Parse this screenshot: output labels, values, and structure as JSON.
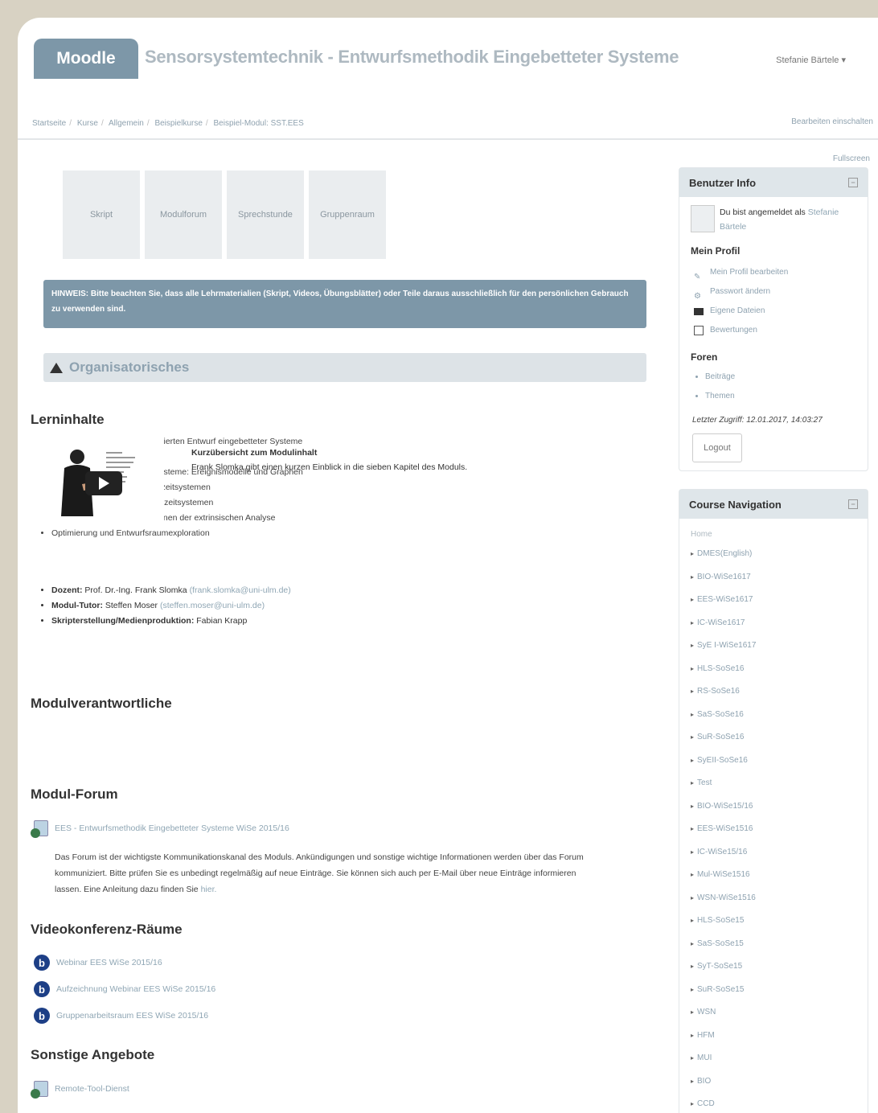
{
  "header": {
    "brand": "Moodle",
    "course_title": "Sensorsystemtechnik - Entwurfsmethodik Eingebetteter Systeme",
    "user_menu": "Stefanie Bärtele ▾"
  },
  "breadcrumb": [
    "Startseite",
    "Kurse",
    "Allgemein",
    "Beispielkurse",
    "Beispiel-Modul: SST.EES"
  ],
  "edit_toggle": "Bearbeiten einschalten",
  "fullscreen": "Fullscreen",
  "tiles": [
    "Skript",
    "Modulforum",
    "Sprechstunde",
    "Gruppenraum"
  ],
  "notice": "HINWEIS: Bitte beachten Sie, dass alle Lehrmaterialien (Skript, Videos, Übungsblätter) oder Teile daraus ausschließlich für den persönlichen Gebrauch zu verwenden sind.",
  "section": {
    "title": "Organisatorisches"
  },
  "lerninhalte": {
    "heading": "Lerninhalte",
    "items": [
      "Übersicht über den modellbasierten Entwurf eingebetteter Systeme",
      "Zeit und Echtzeitsysteme",
      "Modellierung eingebetteter Systeme: Ereignismodelle und Graphen",
      "Intrinsische Analyse von Echtzeitsystemen",
      "Extrinsische Analyse von Echtzeitsystemen",
      "Komplexität und Approximationen der extrinsischen Analyse",
      "Optimierung und Entwurfsraumexploration"
    ]
  },
  "video": {
    "title": "Kurzübersicht zum Modulinhalt",
    "description": "Frank Slomka gibt einen kurzen Einblick in die sieben Kapitel des Moduls."
  },
  "verantwortliche": {
    "heading": "Modulverantwortliche",
    "items": [
      {
        "label": "Dozent:",
        "value": "Prof. Dr.-Ing. Frank Slomka",
        "email": "(frank.slomka@uni-ulm.de)"
      },
      {
        "label": "Modul-Tutor:",
        "value": "Steffen Moser",
        "email": "(steffen.moser@uni-ulm.de)"
      },
      {
        "label": "Skripterstellung/Medienproduktion:",
        "value": "Fabian Krapp",
        "email": ""
      }
    ]
  },
  "forum": {
    "heading": "Modul-Forum",
    "link": "EES - Entwurfsmethodik Eingebetteter Systeme WiSe 2015/16",
    "text": "Das Forum ist der wichtigste Kommunikationskanal des Moduls. Ankündigungen und sonstige wichtige Informationen werden über das Forum kommuniziert. Bitte prüfen Sie es unbedingt regelmäßig auf neue Einträge. Sie können sich auch per E-Mail über neue Einträge informieren lassen. Eine Anleitung dazu finden Sie",
    "here": "hier."
  },
  "video_rooms": {
    "heading": "Videokonferenz-Räume",
    "items": [
      "Webinar EES WiSe 2015/16",
      "Aufzeichnung Webinar EES WiSe 2015/16",
      "Gruppenarbeitsraum EES WiSe 2015/16"
    ]
  },
  "other": {
    "heading": "Sonstige Angebote",
    "link": "Remote-Tool-Dienst"
  },
  "user_info": {
    "title": "Benutzer Info",
    "logged_in_prefix": "Du bist angemeldet als",
    "logged_in_name": "Stefanie Bärtele",
    "profile_heading": "Mein Profil",
    "profile_links": [
      "Mein Profil bearbeiten",
      "Passwort ändern",
      "Eigene Dateien",
      "Bewertungen"
    ],
    "forum_heading": "Foren",
    "forum_links": [
      "Beiträge",
      "Themen"
    ],
    "last_access": "Letzter Zugriff: 12.01.2017, 14:03:27",
    "logout": "Logout"
  },
  "course_nav": {
    "title": "Course Navigation",
    "home": "Home",
    "items": [
      "DMES(English)",
      "BIO-WiSe1617",
      "EES-WiSe1617",
      "IC-WiSe1617",
      "SyE I-WiSe1617",
      "HLS-SoSe16",
      "RS-SoSe16",
      "SaS-SoSe16",
      "SuR-SoSe16",
      "SyEII-SoSe16",
      "Test",
      "BIO-WiSe15/16",
      "EES-WiSe1516",
      "IC-WiSe15/16",
      "Mul-WiSe1516",
      "WSN-WiSe1516",
      "HLS-SoSe15",
      "SaS-SoSe15",
      "SyT-SoSe15",
      "SuR-SoSe15",
      "WSN",
      "HFM",
      "MUI",
      "BIO",
      "CCD"
    ]
  }
}
